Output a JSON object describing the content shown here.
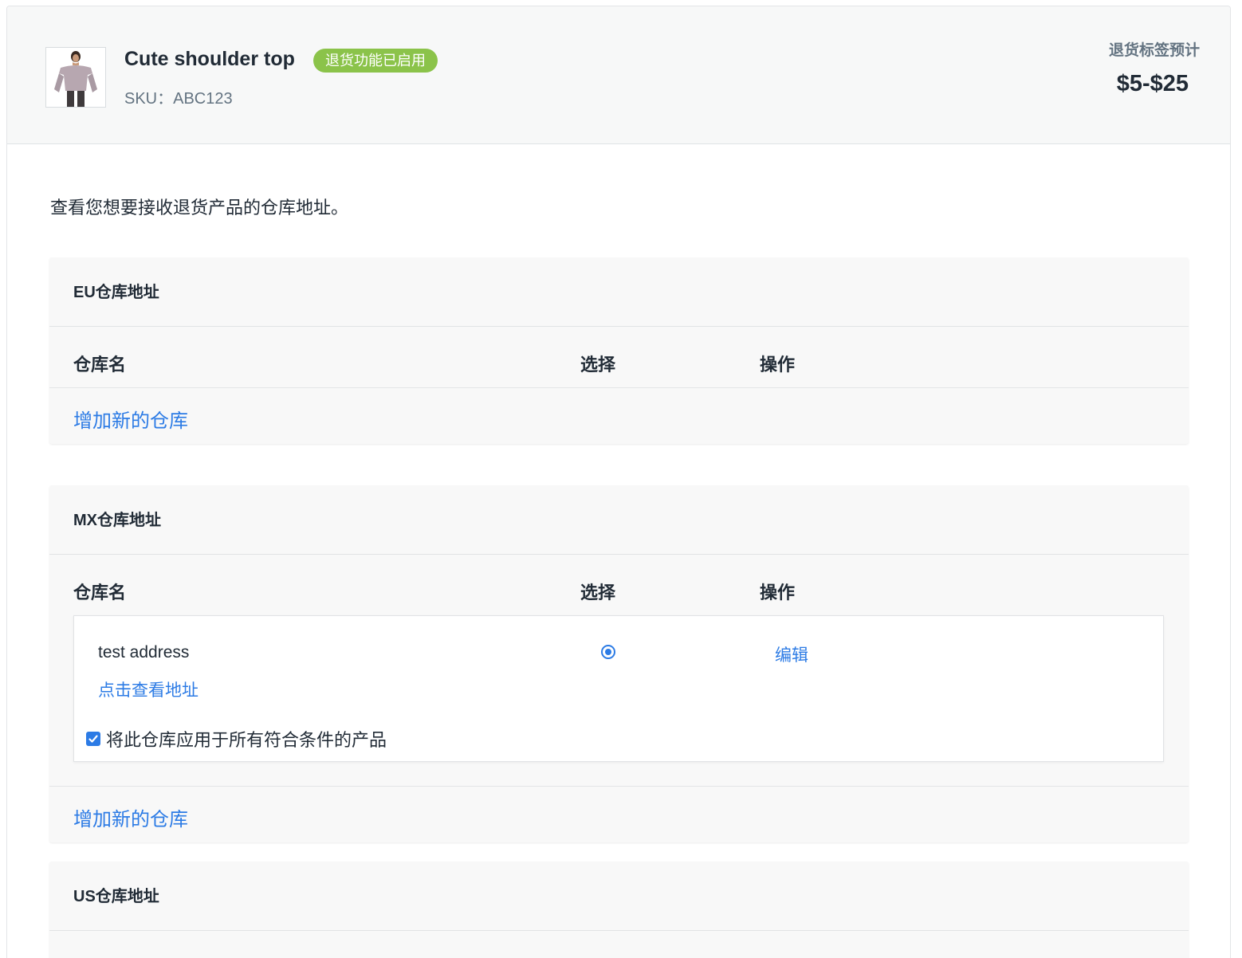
{
  "product": {
    "title": "Cute shoulder top",
    "badge": "退货功能已启用",
    "sku": "SKU：ABC123",
    "estimate_label": "退货标签预计",
    "estimate_value": "$5-$25"
  },
  "intro": "查看您想要接收退货产品的仓库地址。",
  "columns": {
    "name": "仓库名",
    "select": "选择",
    "action": "操作"
  },
  "sections": [
    {
      "title": "EU仓库地址",
      "add_link": "增加新的仓库"
    },
    {
      "title": "MX仓库地址",
      "add_link": "增加新的仓库",
      "warehouse": {
        "name": "test address",
        "view_link": "点击查看地址",
        "selected": true,
        "edit_link": "编辑",
        "apply_all_label": "将此仓库应用于所有符合条件的产品",
        "apply_all_checked": true
      }
    },
    {
      "title": "US仓库地址"
    }
  ],
  "colors": {
    "accent": "#2c7be5",
    "badge": "#8bc34a"
  }
}
